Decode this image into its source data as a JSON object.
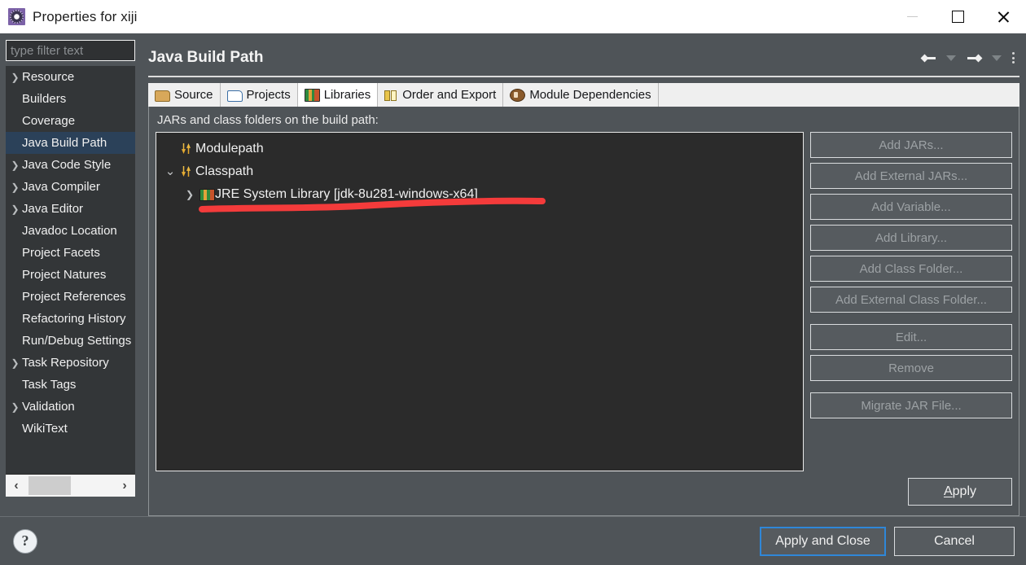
{
  "window": {
    "title": "Properties for xiji",
    "icon": "eclipse-properties-icon",
    "minimize_label": "Minimize",
    "maximize_label": "Maximize",
    "close_label": "Close"
  },
  "sidebar": {
    "filter_placeholder": "type filter text",
    "filter_value": "",
    "items": [
      {
        "label": "Resource",
        "expandable": true,
        "selected": false
      },
      {
        "label": "Builders",
        "expandable": false,
        "selected": false
      },
      {
        "label": "Coverage",
        "expandable": false,
        "selected": false
      },
      {
        "label": "Java Build Path",
        "expandable": false,
        "selected": true
      },
      {
        "label": "Java Code Style",
        "expandable": true,
        "selected": false
      },
      {
        "label": "Java Compiler",
        "expandable": true,
        "selected": false
      },
      {
        "label": "Java Editor",
        "expandable": true,
        "selected": false
      },
      {
        "label": "Javadoc Location",
        "expandable": false,
        "selected": false
      },
      {
        "label": "Project Facets",
        "expandable": false,
        "selected": false
      },
      {
        "label": "Project Natures",
        "expandable": false,
        "selected": false
      },
      {
        "label": "Project References",
        "expandable": false,
        "selected": false
      },
      {
        "label": "Refactoring History",
        "expandable": false,
        "selected": false
      },
      {
        "label": "Run/Debug Settings",
        "expandable": false,
        "selected": false
      },
      {
        "label": "Task Repository",
        "expandable": true,
        "selected": false
      },
      {
        "label": "Task Tags",
        "expandable": false,
        "selected": false
      },
      {
        "label": "Validation",
        "expandable": true,
        "selected": false
      },
      {
        "label": "WikiText",
        "expandable": false,
        "selected": false
      }
    ],
    "scroll_left": "‹",
    "scroll_right": "›"
  },
  "page": {
    "title": "Java Build Path",
    "nav": {
      "back": "back-arrow",
      "back_menu": "back-history-dropdown",
      "forward": "forward-arrow",
      "forward_menu": "forward-history-dropdown",
      "menu": "view-menu"
    }
  },
  "tabs": [
    {
      "label": "Source",
      "icon": "source-folder-icon",
      "active": false
    },
    {
      "label": "Projects",
      "icon": "projects-folder-icon",
      "active": false
    },
    {
      "label": "Libraries",
      "icon": "libraries-books-icon",
      "active": true
    },
    {
      "label": "Order and Export",
      "icon": "order-export-arrows-icon",
      "active": false
    },
    {
      "label": "Module Dependencies",
      "icon": "module-dependencies-icon",
      "active": false
    }
  ],
  "main": {
    "content_label": "JARs and class folders on the build path:",
    "tree": [
      {
        "label": "Modulepath",
        "icon": "path-arrows-icon",
        "indent": 1,
        "chevron": "none"
      },
      {
        "label": "Classpath",
        "icon": "path-arrows-icon",
        "indent": 1,
        "chevron": "expanded"
      },
      {
        "label": "JRE System Library [jdk-8u281-windows-x64]",
        "icon": "jre-library-icon",
        "indent": 2,
        "chevron": "collapsed"
      }
    ],
    "annotation": {
      "type": "red-underline",
      "color": "#f43b3b",
      "target": "JRE System Library [jdk-8u281-windows-x64]"
    },
    "buttons": [
      {
        "label": "Add JARs...",
        "enabled": false
      },
      {
        "label": "Add External JARs...",
        "enabled": false
      },
      {
        "label": "Add Variable...",
        "enabled": false
      },
      {
        "label": "Add Library...",
        "enabled": false
      },
      {
        "label": "Add Class Folder...",
        "enabled": false
      },
      {
        "label": "Add External Class Folder...",
        "enabled": false
      },
      {
        "label": "Edit...",
        "enabled": false
      },
      {
        "label": "Remove",
        "enabled": false
      },
      {
        "label": "Migrate JAR File...",
        "enabled": false
      }
    ],
    "apply_label": "Apply",
    "apply_mnemonic": "A"
  },
  "footer": {
    "help_icon": "help-question-icon",
    "apply_and_close": "Apply and Close",
    "cancel": "Cancel"
  },
  "colors": {
    "dialog_bg": "#4f5458",
    "tree_bg": "#2b2b2b",
    "selection": "#2b4159",
    "annotation_red": "#f43b3b",
    "focus_blue": "#2f87d8"
  }
}
